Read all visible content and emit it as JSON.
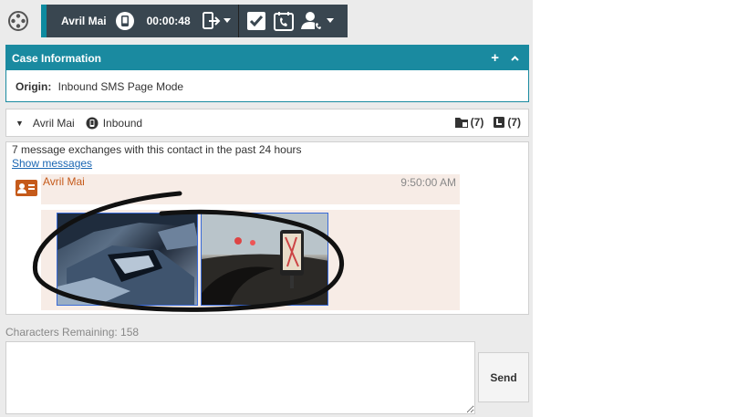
{
  "toolbar": {
    "contact_name": "Avril Mai",
    "timer": "00:00:48"
  },
  "case_info": {
    "title": "Case Information",
    "plus": "+",
    "collapse": "⌃",
    "origin_label": "Origin:",
    "origin_value": "Inbound SMS Page Mode"
  },
  "interaction": {
    "caret": "▼",
    "contact_name": "Avril Mai",
    "direction": "Inbound",
    "case_count": "(7)",
    "history_count": "(7)"
  },
  "transcript": {
    "summary": "7 message exchanges with this contact in the past 24 hours",
    "show_messages": "Show messages",
    "message": {
      "sender": "Avril Mai",
      "time": "9:50:00 AM"
    }
  },
  "composer": {
    "characters_remaining": "Characters Remaining: 158",
    "send_label": "Send"
  },
  "colors": {
    "accent": "#1a8aa0",
    "dark_bar": "#394650",
    "sender": "#c55a1a",
    "message_bg": "#f7ece6",
    "link": "#1a66b3"
  },
  "icons": [
    "settings-icon",
    "phone-icon",
    "transfer-icon",
    "checkmark-icon",
    "schedule-call-icon",
    "consult-icon",
    "chevron-down-icon",
    "case-icon",
    "history-icon",
    "contact-card-icon"
  ]
}
